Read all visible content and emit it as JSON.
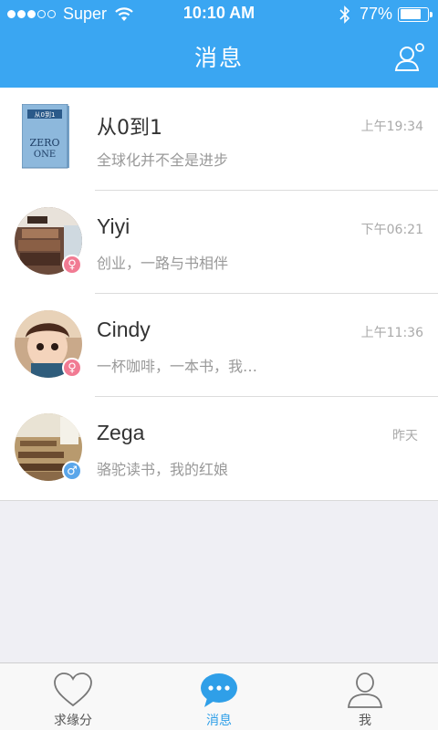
{
  "status_bar": {
    "carrier": "Super",
    "time": "10:10 AM",
    "battery_text": "77%",
    "battery_level": 0.77,
    "signal_bars_filled": 3,
    "signal_bars_total": 5
  },
  "nav": {
    "title": "消息",
    "contacts_icon": "contacts-icon"
  },
  "messages": [
    {
      "name": "从0到1",
      "preview": "全球化并不全是进步",
      "time": "上午19:34",
      "avatar": "book-cover",
      "gender": ""
    },
    {
      "name": "Yiyi",
      "preview": "创业，一路与书相伴",
      "time": "下午06:21",
      "avatar": "bookshelf-photo",
      "gender": "♀"
    },
    {
      "name": "Cindy",
      "preview": "一杯咖啡，一本书，我…",
      "time": "上午11:36",
      "avatar": "cartoon-girl-photo",
      "gender": "♀"
    },
    {
      "name": "Zega",
      "preview": "骆驼读书，我的红娘",
      "time": "昨天",
      "avatar": "library-photo",
      "gender": "♂"
    }
  ],
  "book_cover": {
    "title_top": "从0到1",
    "title_main": "ZERO",
    "title_sub": "ONE"
  },
  "tabs": [
    {
      "label": "求缘分",
      "icon": "heart-icon",
      "active": false
    },
    {
      "label": "消息",
      "icon": "chat-bubble-icon",
      "active": true
    },
    {
      "label": "我",
      "icon": "person-icon",
      "active": false
    }
  ],
  "colors": {
    "brand_blue": "#3aa6f2",
    "active_tab": "#2f9fe8",
    "female": "#f17b93",
    "male": "#5aa6ea"
  }
}
